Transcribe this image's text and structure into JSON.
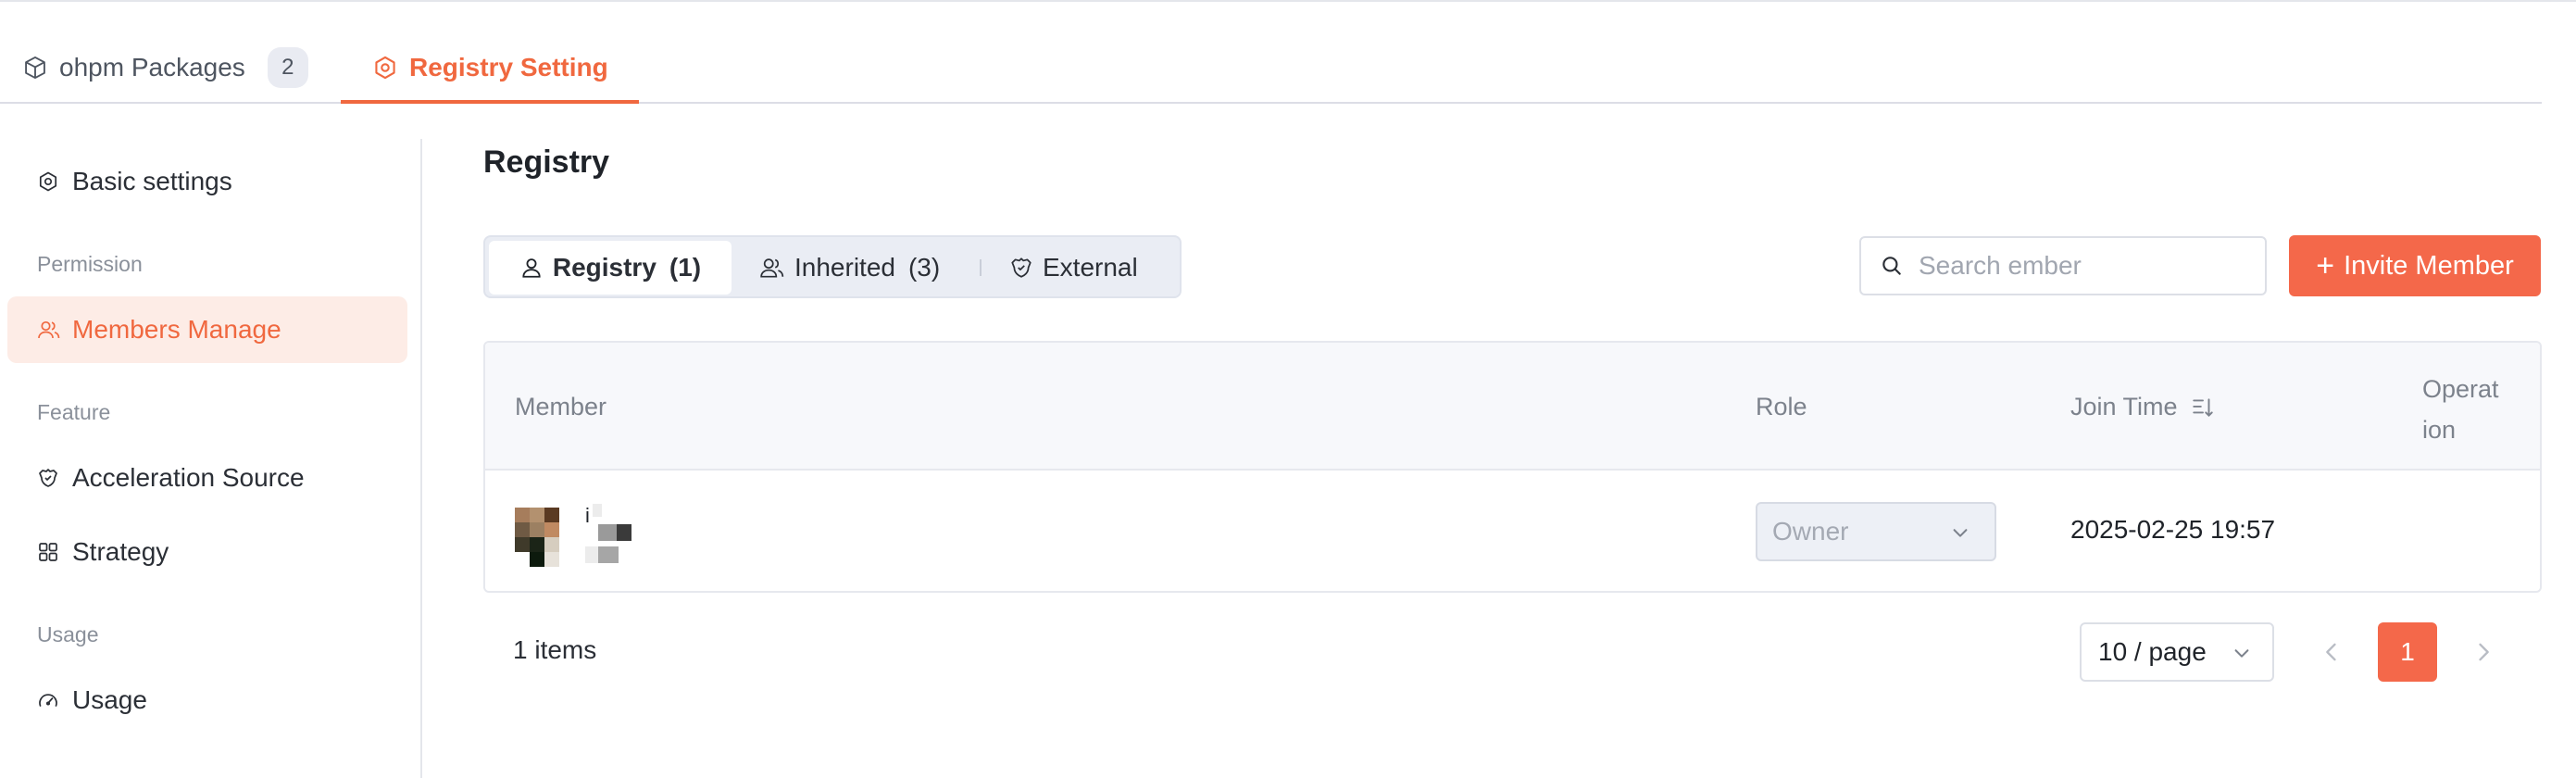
{
  "tabs": {
    "packages_label": "ohpm Packages",
    "packages_count": "2",
    "registry_setting_label": "Registry Setting"
  },
  "sidebar": {
    "basic_settings": "Basic settings",
    "group_permission": "Permission",
    "members_manage": "Members Manage",
    "group_feature": "Feature",
    "acceleration_source": "Acceleration Source",
    "strategy": "Strategy",
    "group_usage": "Usage",
    "usage": "Usage"
  },
  "main": {
    "title": "Registry"
  },
  "segments": {
    "registry_label": "Registry",
    "registry_count": "(1)",
    "inherited_label": "Inherited",
    "inherited_count": "(3)",
    "external_label": "External"
  },
  "search": {
    "placeholder": "Search ember"
  },
  "invite_button": {
    "label": "Invite Member"
  },
  "table": {
    "columns": {
      "member": "Member",
      "role": "Role",
      "join_time": "Join Time",
      "operation": "Operat ion"
    },
    "rows": [
      {
        "member_name_text": "i",
        "role": "Owner",
        "join_time": "2025-02-25 19:57"
      }
    ]
  },
  "pagination": {
    "items_text": "1 items",
    "page_size": "10 / page",
    "current_page": "1"
  },
  "colors": {
    "accent": "#f0683f",
    "accent_button": "#f4684a",
    "active_bg": "#fdece6"
  },
  "icons": {
    "packages_tab": "package-cube-icon",
    "registry_setting_tab": "gear-hexagon-icon",
    "basic_settings": "gear-hexagon-icon",
    "members": "users-icon",
    "acceleration": "shield-icon",
    "strategy": "grid-icon",
    "usage": "gauge-icon",
    "search": "search-icon",
    "sort": "sort-icon",
    "chevron": "chevron-down-icon"
  }
}
